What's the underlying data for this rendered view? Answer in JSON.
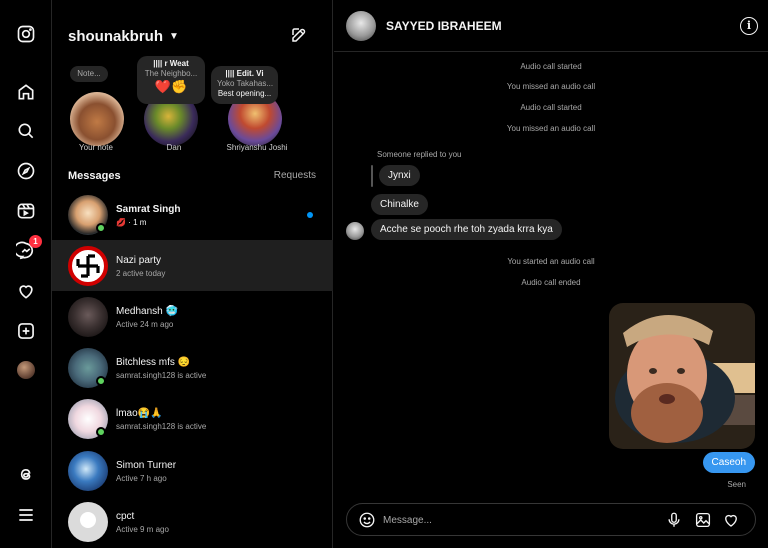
{
  "rail": {
    "message_badge": "1"
  },
  "inbox": {
    "username": "shounakbruh",
    "messages_title": "Messages",
    "requests_label": "Requests",
    "notes": [
      {
        "name": "Your note",
        "bubble_line1": "Note..."
      },
      {
        "name": "Dan",
        "bubble_line1": "r Weat",
        "bubble_line2": "The Neighbo...",
        "bubble_line3": "❤️✊"
      },
      {
        "name": "Shriyanshu Joshi",
        "bubble_line1": "Edit. Vi",
        "bubble_line2": "Yoko Takahas...",
        "bubble_line3": "Best opening..."
      }
    ],
    "threads": [
      {
        "name": "Samrat Singh",
        "sub": "💋 · 1 m"
      },
      {
        "name": "Nazi party",
        "sub": "2 active today"
      },
      {
        "name": "Medhansh 🥶",
        "sub": "Active 24 m ago"
      },
      {
        "name": "Bitchless mfs 😔",
        "sub": "samrat.singh128 is active"
      },
      {
        "name": "lmao😭🙏",
        "sub": "samrat.singh128 is active"
      },
      {
        "name": "Simon Turner",
        "sub": "Active 7 h ago"
      },
      {
        "name": "cpct",
        "sub": "Active 9 m ago"
      }
    ]
  },
  "chat": {
    "title": "SAYYED IBRAHEEM",
    "system": [
      "Audio call started",
      "You missed an audio call",
      "Audio call started",
      "You missed an audio call",
      "You started an audio call",
      "Audio call ended"
    ],
    "reply_label": "Someone replied to you",
    "quoted": "Jynxi",
    "messages": [
      "Chinalke",
      "Acche se pooch rhe toh zyada krra kya"
    ],
    "sent_message": "Caseoh",
    "seen": "Seen",
    "composer_placeholder": "Message..."
  },
  "colors": {
    "accent_blue": "#3797f0",
    "online_green": "#5fd35f",
    "badge_red": "#ff3040",
    "unread_dot": "#0095f6"
  }
}
